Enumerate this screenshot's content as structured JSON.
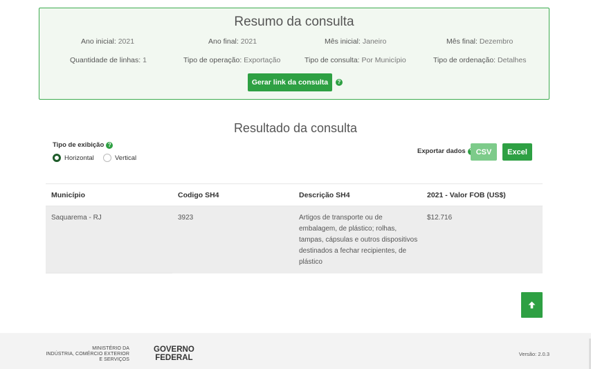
{
  "summary": {
    "title": "Resumo da consulta",
    "items": [
      {
        "label": "Ano inicial:",
        "value": "2021"
      },
      {
        "label": "Ano final:",
        "value": "2021"
      },
      {
        "label": "Mês inicial:",
        "value": "Janeiro"
      },
      {
        "label": "Mês final:",
        "value": "Dezembro"
      },
      {
        "label": "Quantidade de linhas:",
        "value": "1"
      },
      {
        "label": "Tipo de operação:",
        "value": "Exportação"
      },
      {
        "label": "Tipo de consulta:",
        "value": "Por Município"
      },
      {
        "label": "Tipo de ordenação:",
        "value": "Detalhes"
      }
    ],
    "generate_link_label": "Gerar link da consulta"
  },
  "result": {
    "title": "Resultado da consulta",
    "display_type_label": "Tipo de exibição",
    "display_options": [
      "Horizontal",
      "Vertical"
    ],
    "selected_display": "Horizontal",
    "export_label": "Exportar dados",
    "csv_label": "CSV",
    "excel_label": "Excel"
  },
  "table": {
    "headers": [
      "Município",
      "Codigo SH4",
      "Descrição SH4",
      "2021 - Valor FOB (US$)"
    ],
    "rows": [
      [
        "Saquarema - RJ",
        "3923",
        "Artigos de transporte ou de embalagem, de plástico; rolhas, tampas, cápsulas e outros dispositivos destinados a fechar recipientes, de plástico",
        "$12.716"
      ]
    ]
  },
  "footer": {
    "ministry_lines": [
      "MINISTÉRIO DA",
      "INDÚSTRIA, COMÉRCIO EXTERIOR",
      "E SERVIÇOS"
    ],
    "gov_lines": [
      "GOVERNO",
      "FEDERAL"
    ],
    "version": "Versão: 2.0.3"
  },
  "colors": {
    "accent": "#2ea043",
    "accent_light": "#7dcb8a",
    "summary_bg": "#f2f8f1"
  },
  "icons": {
    "help": "question-circle-icon",
    "scroll_top": "arrow-up-icon"
  }
}
